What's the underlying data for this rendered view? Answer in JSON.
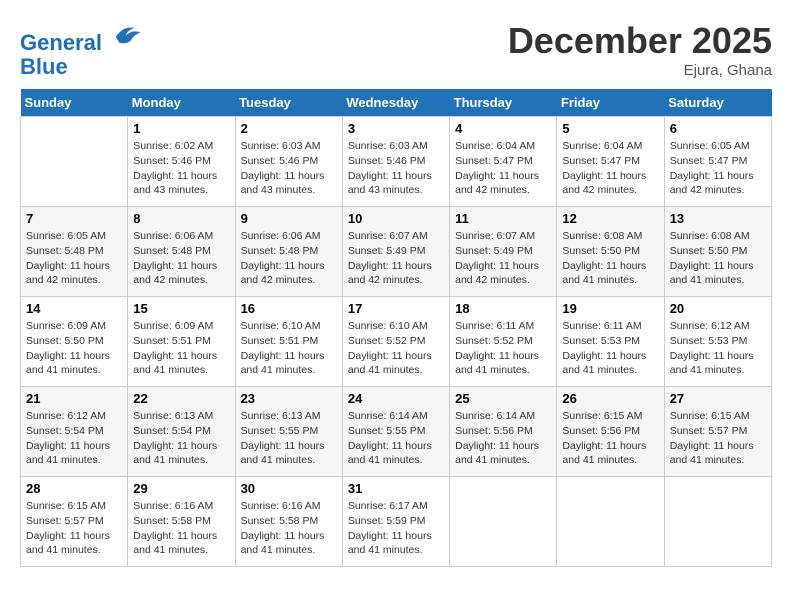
{
  "header": {
    "logo_line1": "General",
    "logo_line2": "Blue",
    "month": "December 2025",
    "location": "Ejura, Ghana"
  },
  "days_of_week": [
    "Sunday",
    "Monday",
    "Tuesday",
    "Wednesday",
    "Thursday",
    "Friday",
    "Saturday"
  ],
  "weeks": [
    [
      {
        "day": "",
        "info": ""
      },
      {
        "day": "1",
        "info": "Sunrise: 6:02 AM\nSunset: 5:46 PM\nDaylight: 11 hours\nand 43 minutes."
      },
      {
        "day": "2",
        "info": "Sunrise: 6:03 AM\nSunset: 5:46 PM\nDaylight: 11 hours\nand 43 minutes."
      },
      {
        "day": "3",
        "info": "Sunrise: 6:03 AM\nSunset: 5:46 PM\nDaylight: 11 hours\nand 43 minutes."
      },
      {
        "day": "4",
        "info": "Sunrise: 6:04 AM\nSunset: 5:47 PM\nDaylight: 11 hours\nand 42 minutes."
      },
      {
        "day": "5",
        "info": "Sunrise: 6:04 AM\nSunset: 5:47 PM\nDaylight: 11 hours\nand 42 minutes."
      },
      {
        "day": "6",
        "info": "Sunrise: 6:05 AM\nSunset: 5:47 PM\nDaylight: 11 hours\nand 42 minutes."
      }
    ],
    [
      {
        "day": "7",
        "info": "Sunrise: 6:05 AM\nSunset: 5:48 PM\nDaylight: 11 hours\nand 42 minutes."
      },
      {
        "day": "8",
        "info": "Sunrise: 6:06 AM\nSunset: 5:48 PM\nDaylight: 11 hours\nand 42 minutes."
      },
      {
        "day": "9",
        "info": "Sunrise: 6:06 AM\nSunset: 5:48 PM\nDaylight: 11 hours\nand 42 minutes."
      },
      {
        "day": "10",
        "info": "Sunrise: 6:07 AM\nSunset: 5:49 PM\nDaylight: 11 hours\nand 42 minutes."
      },
      {
        "day": "11",
        "info": "Sunrise: 6:07 AM\nSunset: 5:49 PM\nDaylight: 11 hours\nand 42 minutes."
      },
      {
        "day": "12",
        "info": "Sunrise: 6:08 AM\nSunset: 5:50 PM\nDaylight: 11 hours\nand 41 minutes."
      },
      {
        "day": "13",
        "info": "Sunrise: 6:08 AM\nSunset: 5:50 PM\nDaylight: 11 hours\nand 41 minutes."
      }
    ],
    [
      {
        "day": "14",
        "info": "Sunrise: 6:09 AM\nSunset: 5:50 PM\nDaylight: 11 hours\nand 41 minutes."
      },
      {
        "day": "15",
        "info": "Sunrise: 6:09 AM\nSunset: 5:51 PM\nDaylight: 11 hours\nand 41 minutes."
      },
      {
        "day": "16",
        "info": "Sunrise: 6:10 AM\nSunset: 5:51 PM\nDaylight: 11 hours\nand 41 minutes."
      },
      {
        "day": "17",
        "info": "Sunrise: 6:10 AM\nSunset: 5:52 PM\nDaylight: 11 hours\nand 41 minutes."
      },
      {
        "day": "18",
        "info": "Sunrise: 6:11 AM\nSunset: 5:52 PM\nDaylight: 11 hours\nand 41 minutes."
      },
      {
        "day": "19",
        "info": "Sunrise: 6:11 AM\nSunset: 5:53 PM\nDaylight: 11 hours\nand 41 minutes."
      },
      {
        "day": "20",
        "info": "Sunrise: 6:12 AM\nSunset: 5:53 PM\nDaylight: 11 hours\nand 41 minutes."
      }
    ],
    [
      {
        "day": "21",
        "info": "Sunrise: 6:12 AM\nSunset: 5:54 PM\nDaylight: 11 hours\nand 41 minutes."
      },
      {
        "day": "22",
        "info": "Sunrise: 6:13 AM\nSunset: 5:54 PM\nDaylight: 11 hours\nand 41 minutes."
      },
      {
        "day": "23",
        "info": "Sunrise: 6:13 AM\nSunset: 5:55 PM\nDaylight: 11 hours\nand 41 minutes."
      },
      {
        "day": "24",
        "info": "Sunrise: 6:14 AM\nSunset: 5:55 PM\nDaylight: 11 hours\nand 41 minutes."
      },
      {
        "day": "25",
        "info": "Sunrise: 6:14 AM\nSunset: 5:56 PM\nDaylight: 11 hours\nand 41 minutes."
      },
      {
        "day": "26",
        "info": "Sunrise: 6:15 AM\nSunset: 5:56 PM\nDaylight: 11 hours\nand 41 minutes."
      },
      {
        "day": "27",
        "info": "Sunrise: 6:15 AM\nSunset: 5:57 PM\nDaylight: 11 hours\nand 41 minutes."
      }
    ],
    [
      {
        "day": "28",
        "info": "Sunrise: 6:15 AM\nSunset: 5:57 PM\nDaylight: 11 hours\nand 41 minutes."
      },
      {
        "day": "29",
        "info": "Sunrise: 6:16 AM\nSunset: 5:58 PM\nDaylight: 11 hours\nand 41 minutes."
      },
      {
        "day": "30",
        "info": "Sunrise: 6:16 AM\nSunset: 5:58 PM\nDaylight: 11 hours\nand 41 minutes."
      },
      {
        "day": "31",
        "info": "Sunrise: 6:17 AM\nSunset: 5:59 PM\nDaylight: 11 hours\nand 41 minutes."
      },
      {
        "day": "",
        "info": ""
      },
      {
        "day": "",
        "info": ""
      },
      {
        "day": "",
        "info": ""
      }
    ]
  ]
}
